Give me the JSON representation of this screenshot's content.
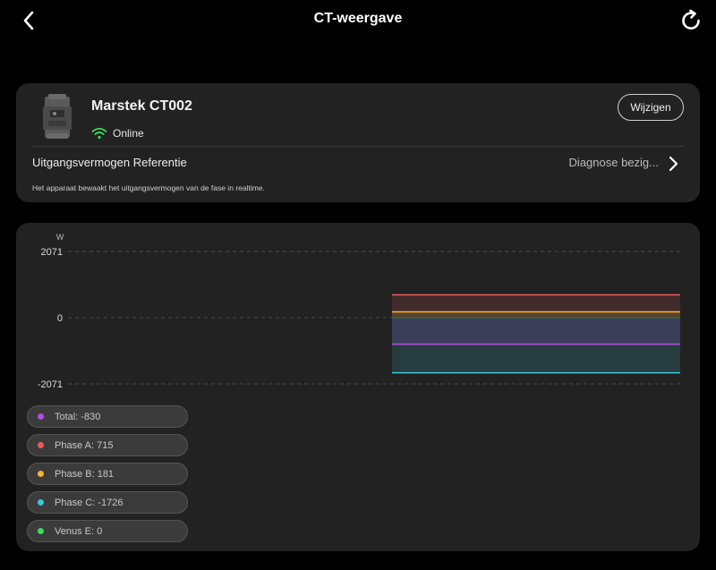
{
  "header": {
    "title": "CT-weergave"
  },
  "device": {
    "name": "Marstek CT002",
    "status": "Online",
    "edit_label": "Wijzigen",
    "reference_label": "Uitgangsvermogen Referentie",
    "reference_value": "Diagnose bezig...",
    "description": "Het apparaat bewaakt het uitgangsvermogen van de fase in realtime."
  },
  "colors": {
    "background": "#000000",
    "card": "#222222",
    "online_green": "#3ddc5a",
    "total": "#b44ce6",
    "phase_a": "#ef5b5b",
    "phase_b": "#f2b52f",
    "phase_c": "#3cc8d8",
    "venus_e": "#3ddc5a"
  },
  "chart_data": {
    "type": "area",
    "ylabel": "W",
    "ylim": [
      -2071,
      2071
    ],
    "yticks": [
      "2071",
      "0",
      "-2071"
    ],
    "grid": true,
    "series": [
      {
        "name": "Total",
        "value": -830,
        "color": "#b44ce6"
      },
      {
        "name": "Phase A",
        "value": 715,
        "color": "#ef5b5b"
      },
      {
        "name": "Phase B",
        "value": 181,
        "color": "#f2b52f"
      },
      {
        "name": "Phase C",
        "value": -1726,
        "color": "#3cc8d8"
      },
      {
        "name": "Venus E",
        "value": 0,
        "color": "#3ddc5a"
      }
    ]
  },
  "legend": [
    {
      "label": "Total: -830",
      "color": "#b44ce6"
    },
    {
      "label": "Phase A: 715",
      "color": "#ef5b5b"
    },
    {
      "label": "Phase B: 181",
      "color": "#f2b52f"
    },
    {
      "label": "Phase C: -1726",
      "color": "#3cc8d8"
    },
    {
      "label": "Venus E: 0",
      "color": "#3ddc5a"
    }
  ]
}
